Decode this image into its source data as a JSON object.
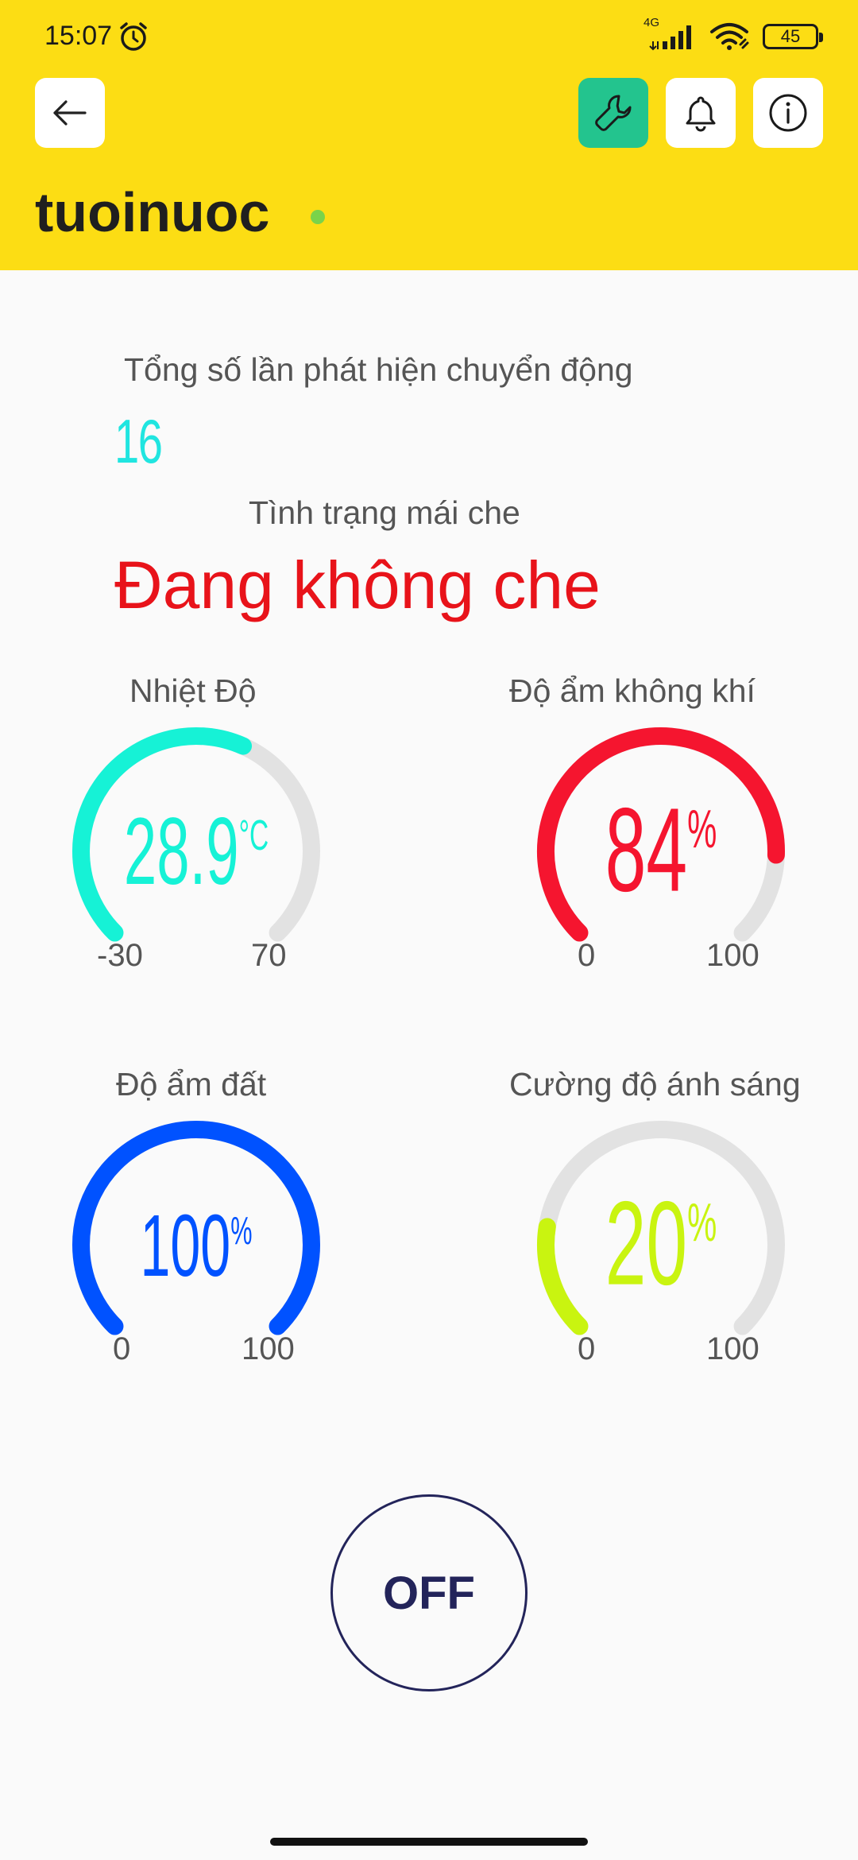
{
  "status": {
    "time": "15:07",
    "network": "4G",
    "battery": "45"
  },
  "header": {
    "title": "tuoinuoc"
  },
  "motion": {
    "label": "Tổng số lần phát hiện chuyển động",
    "value": "16"
  },
  "roof": {
    "label": "Tình trạng mái che",
    "value": "Đang không che"
  },
  "gauges": [
    {
      "title": "Nhiệt Độ",
      "value": 28.9,
      "display": "28.9",
      "unit": "°C",
      "min": -30,
      "max": 70,
      "min_label": "-30",
      "max_label": "70",
      "color": "#16f2d6"
    },
    {
      "title": "Độ ẩm không khí",
      "value": 84,
      "display": "84",
      "unit": "%",
      "min": 0,
      "max": 100,
      "min_label": "0",
      "max_label": "100",
      "color": "#f5152f"
    },
    {
      "title": "Độ ẩm đất",
      "value": 100,
      "display": "100",
      "unit": "%",
      "min": 0,
      "max": 100,
      "min_label": "0",
      "max_label": "100",
      "color": "#0052ff"
    },
    {
      "title": "Cường độ ánh sáng",
      "value": 20,
      "display": "20",
      "unit": "%",
      "min": 0,
      "max": 100,
      "min_label": "0",
      "max_label": "100",
      "color": "#c9f410"
    }
  ],
  "button": {
    "label": "OFF"
  },
  "colors": {
    "header_bg": "#fcdd14",
    "accent_green": "#23c48e",
    "track": "#e2e2e2"
  }
}
